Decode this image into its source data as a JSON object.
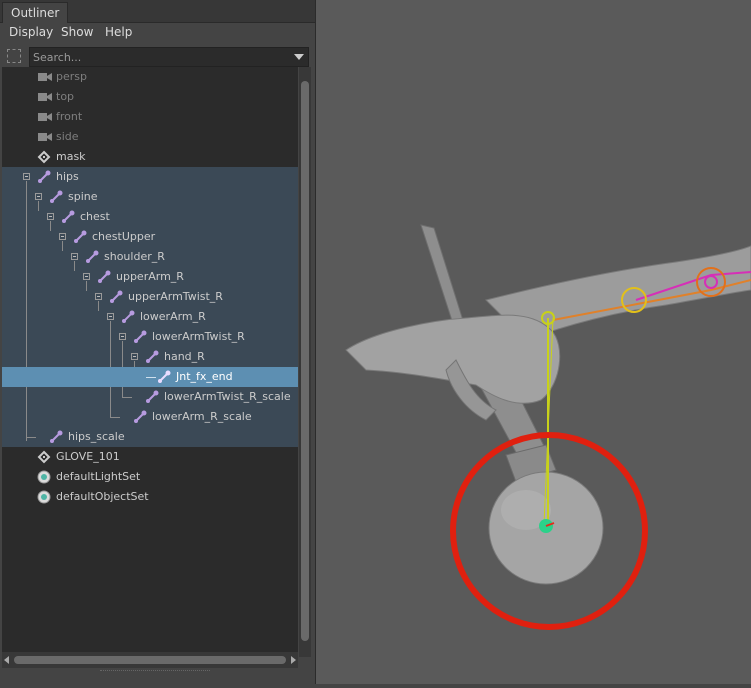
{
  "window": {
    "tab_title": "Outliner"
  },
  "menus": [
    "Display",
    "Show",
    "Help"
  ],
  "search": {
    "placeholder": "Search..."
  },
  "tree": {
    "items": [
      {
        "label": "persp",
        "kind": "camera"
      },
      {
        "label": "top",
        "kind": "camera"
      },
      {
        "label": "front",
        "kind": "camera"
      },
      {
        "label": "side",
        "kind": "camera"
      },
      {
        "label": "mask",
        "kind": "transform"
      },
      {
        "label": "hips",
        "kind": "joint"
      },
      {
        "label": "spine",
        "kind": "joint"
      },
      {
        "label": "chest",
        "kind": "joint"
      },
      {
        "label": "chestUpper",
        "kind": "joint"
      },
      {
        "label": "shoulder_R",
        "kind": "joint"
      },
      {
        "label": "upperArm_R",
        "kind": "joint"
      },
      {
        "label": "upperArmTwist_R",
        "kind": "joint"
      },
      {
        "label": "lowerArm_R",
        "kind": "joint"
      },
      {
        "label": "lowerArmTwist_R",
        "kind": "joint"
      },
      {
        "label": "hand_R",
        "kind": "joint"
      },
      {
        "label": "Jnt_fx_end",
        "kind": "joint"
      },
      {
        "label": "lowerArmTwist_R_scale",
        "kind": "joint"
      },
      {
        "label": "lowerArm_R_scale",
        "kind": "joint"
      },
      {
        "label": "hips_scale",
        "kind": "joint"
      },
      {
        "label": "GLOVE_101",
        "kind": "transform"
      },
      {
        "label": "defaultLightSet",
        "kind": "set"
      },
      {
        "label": "defaultObjectSet",
        "kind": "set"
      }
    ]
  },
  "colors": {
    "selection": "#3b4956",
    "highlight": "#5d8fb2",
    "joint_icon": "#b79be0",
    "annotation_circle": "#e0200f"
  },
  "icons": {
    "camera": "camera-icon",
    "joint": "joint-icon",
    "transform": "transform-icon",
    "set": "set-icon"
  }
}
